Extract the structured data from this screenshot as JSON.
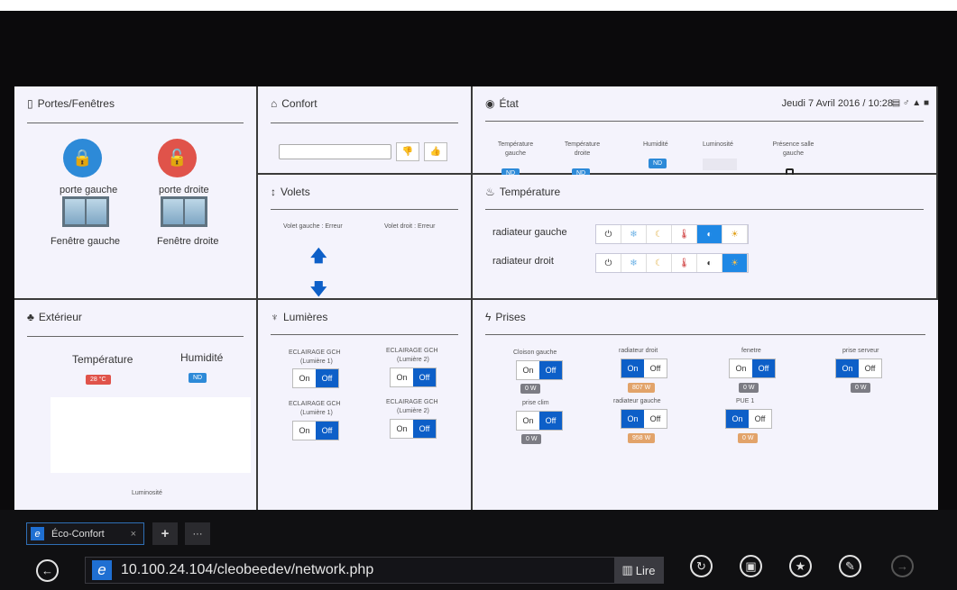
{
  "portes": {
    "title": "Portes/Fenêtres",
    "porte_gauche": "porte gauche",
    "porte_droite": "porte droite",
    "fenetre_gauche": "Fenêtre gauche",
    "fenetre_droite": "Fenêtre droite"
  },
  "confort": {
    "title": "Confort"
  },
  "etat": {
    "title": "État",
    "datetime": "Jeudi 7 Avril 2016 / 10:28",
    "cols": [
      {
        "label": "Température gauche",
        "value": "ND"
      },
      {
        "label": "Température droite",
        "value": "ND"
      },
      {
        "label": "Humidité",
        "value": "ND"
      },
      {
        "label": "Luminosité",
        "value": ""
      },
      {
        "label": "Présence salle gauche",
        "value": ""
      }
    ]
  },
  "volets": {
    "title": "Volets",
    "gauche": "Volet gauche : Erreur",
    "droit": "Volet droit : Erreur"
  },
  "temperature": {
    "title": "Température",
    "rad_gauche": "radiateur gauche",
    "rad_droit": "radiateur droit"
  },
  "exterieur": {
    "title": "Extérieur",
    "temp_label": "Température",
    "hum_label": "Humidité",
    "temp_value": "28 °C",
    "hum_value": "ND",
    "lum_label": "Luminosité"
  },
  "lumieres": {
    "title": "Lumières",
    "items": [
      {
        "name": "ECLAIRAGE GCH",
        "sub": "(Lumière 1)",
        "on": "On",
        "off": "Off"
      },
      {
        "name": "ECLAIRAGE GCH",
        "sub": "(Lumière 2)",
        "on": "On",
        "off": "Off"
      },
      {
        "name": "ECLAIRAGE GCH",
        "sub": "(Lumière 1)",
        "on": "On",
        "off": "Off"
      },
      {
        "name": "ECLAIRAGE GCH",
        "sub": "(Lumière 2)",
        "on": "On",
        "off": "Off"
      }
    ]
  },
  "prises": {
    "title": "Prises",
    "items": [
      {
        "name": "Cloison gauche",
        "on": "On",
        "off": "Off",
        "watt": "0 W"
      },
      {
        "name": "radiateur droit",
        "on": "On",
        "off": "Off",
        "watt": "807 W"
      },
      {
        "name": "fenetre",
        "on": "On",
        "off": "Off",
        "watt": "0 W"
      },
      {
        "name": "prise serveur",
        "on": "On",
        "off": "Off",
        "watt": "0 W"
      },
      {
        "name": "prise clim",
        "on": "On",
        "off": "Off",
        "watt": "0 W"
      },
      {
        "name": "radiateur gauche",
        "on": "On",
        "off": "Off",
        "watt": "958 W"
      },
      {
        "name": "PUE 1",
        "on": "On",
        "off": "Off",
        "watt": "0 W"
      }
    ]
  },
  "browser": {
    "tab_title": "Éco-Confort",
    "new_tab": "+",
    "more": "···",
    "url": "10.100.24.104/cleobeedev/network.php",
    "read": "Lire"
  },
  "colors": {
    "accent": "#0d5fc8",
    "red": "#e0534a",
    "blue": "#2d8ad8"
  }
}
